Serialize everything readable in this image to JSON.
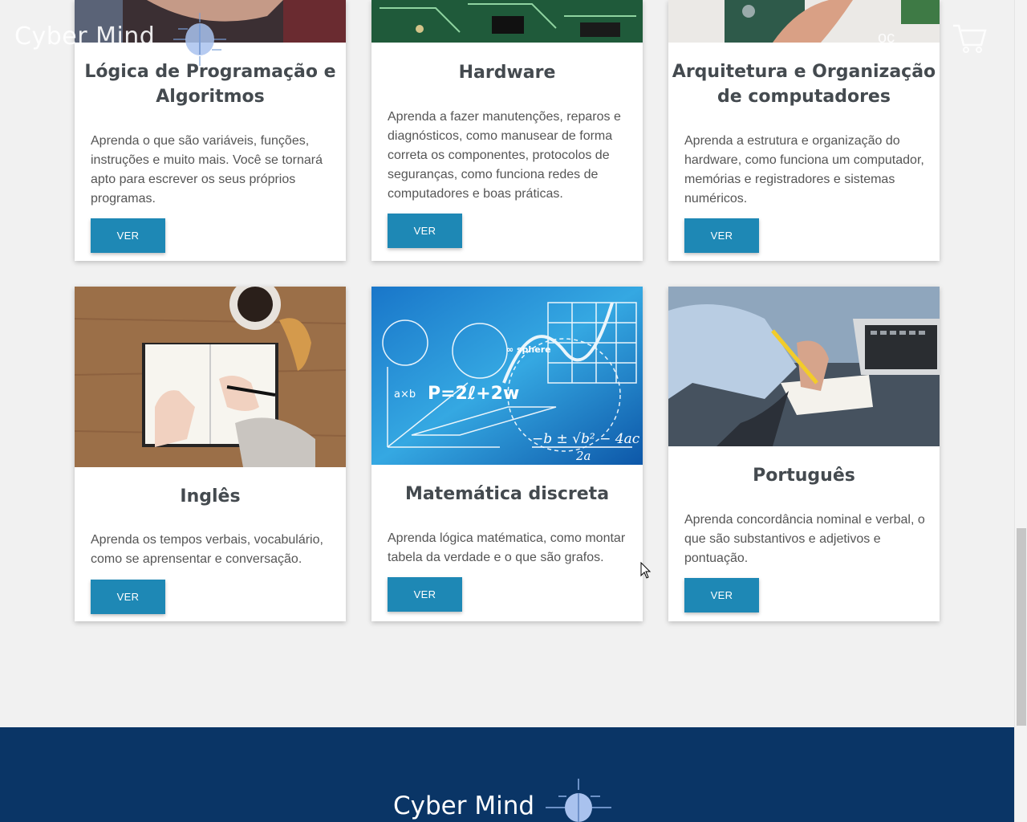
{
  "header": {
    "brand": "Cyber Mind",
    "nav_partial": "oc"
  },
  "courses": [
    {
      "title": "Lógica de Programação e Algoritmos",
      "description": "Aprenda o que são variáveis, funções, instruções e muito mais. Você se tornará apto para escrever os seus próprios programas.",
      "button": "VER"
    },
    {
      "title": "Hardware",
      "description": "Aprenda a fazer manutenções, reparos e diagnósticos, como manusear de forma correta os componentes, protocolos de seguranças, como funciona redes de computadores e boas práticas.",
      "button": "VER"
    },
    {
      "title": "Arquitetura e Organização de computadores",
      "description": "Aprenda a estrutura e organização do hardware, como funciona um computador, memórias e registradores e sistemas numéricos.",
      "button": "VER"
    },
    {
      "title": "Inglês",
      "description": "Aprenda os tempos verbais, vocabulário, como se aprensentar e conversação.",
      "button": "VER"
    },
    {
      "title": "Matemática discreta",
      "description": "Aprenda lógica matématica, como montar tabela da verdade e o que são grafos.",
      "button": "VER"
    },
    {
      "title": "Português",
      "description": "Aprenda concordância nominal e verbal, o que são substantivos e adjetivos e pontuação.",
      "button": "VER"
    }
  ],
  "math_image_text": {
    "formula1": "P=2ℓ+2w",
    "formula2": "−b ± √b² − 4ac",
    "formula3": "2a",
    "label_axb": "a×b",
    "label_sphere": "∞ sphere"
  },
  "footer": {
    "brand": "Cyber Mind"
  },
  "colors": {
    "button": "#1e88b5",
    "footer": "#0a3566",
    "title": "#444a4f"
  }
}
